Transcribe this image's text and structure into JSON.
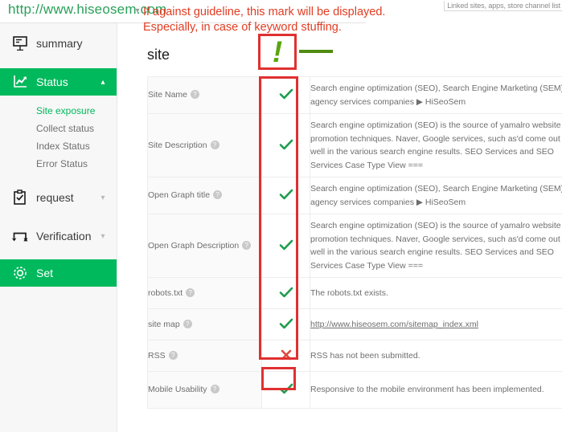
{
  "browser": {
    "url": "http://www.hiseosem.com",
    "url_caret_icon": "chevron-down-icon"
  },
  "top_right_note": "Linked sites, apps, store channel list",
  "annotation": {
    "line1": "If against guideline, this mark will be displayed.",
    "line2": "Especially, in case of keyword stuffing.",
    "exclamation_mark": "!",
    "box_color": "#e03030",
    "text_color": "#e03c22",
    "mark_color": "#5aa50f"
  },
  "sidebar": {
    "items": [
      {
        "label": "summary",
        "icon": "presentation-chart-icon",
        "active": false,
        "chevron": ""
      },
      {
        "label": "Status",
        "icon": "line-chart-icon",
        "active": true,
        "chevron": "chevron-up-icon"
      },
      {
        "label": "request",
        "icon": "clipboard-check-icon",
        "active": false,
        "chevron": "chevron-down-icon"
      },
      {
        "label": "Verification",
        "icon": "exchange-arrows-icon",
        "active": false,
        "chevron": "chevron-down-icon"
      },
      {
        "label": "Set",
        "icon": "gear-icon",
        "active": true,
        "chevron": ""
      }
    ],
    "status_subitems": [
      {
        "label": "Site exposure",
        "active": true
      },
      {
        "label": "Collect status",
        "active": false
      },
      {
        "label": "Index Status",
        "active": false
      },
      {
        "label": "Error Status",
        "active": false
      }
    ],
    "accent_color": "#00b95c"
  },
  "main": {
    "title": "site",
    "table": {
      "rows": [
        {
          "label": "Site Name",
          "status": "ok",
          "status_icon": "check-icon",
          "detail": "Search engine optimization (SEO), Search Engine Marketing (SEM) agency services companies ▶ HiSeoSem",
          "is_link": false
        },
        {
          "label": "Site Description",
          "status": "ok",
          "status_icon": "check-icon",
          "detail": "Search engine optimization (SEO) is the source of yamalro website promotion techniques. Naver, Google services, such as'd come out well in the various search engine results. SEO Services and SEO Services Case Type View ===",
          "is_link": false
        },
        {
          "label": "Open Graph title",
          "status": "ok",
          "status_icon": "check-icon",
          "detail": "Search engine optimization (SEO), Search Engine Marketing (SEM) agency services companies ▶ HiSeoSem",
          "is_link": false
        },
        {
          "label": "Open Graph Description",
          "status": "ok",
          "status_icon": "check-icon",
          "detail": "Search engine optimization (SEO) is the source of yamalro website promotion techniques. Naver, Google services, such as'd come out well in the various search engine results. SEO Services and SEO Services Case Type View ===",
          "is_link": false
        },
        {
          "label": "robots.txt",
          "status": "ok",
          "status_icon": "check-icon",
          "detail": "The robots.txt exists.",
          "is_link": false
        },
        {
          "label": "site map",
          "status": "ok",
          "status_icon": "check-icon",
          "detail": "http://www.hiseosem.com/sitemap_index.xml",
          "is_link": true
        },
        {
          "label": "RSS",
          "status": "bad",
          "status_icon": "cross-icon",
          "detail": "RSS has not been submitted.",
          "is_link": false
        },
        {
          "label": "Mobile Usability",
          "status": "ok",
          "status_icon": "check-icon",
          "detail": "Responsive to the mobile environment has been implemented.",
          "is_link": false
        }
      ],
      "help_glyph": "?",
      "ok_color": "#1f9d4d",
      "bad_color": "#e0483c"
    }
  }
}
